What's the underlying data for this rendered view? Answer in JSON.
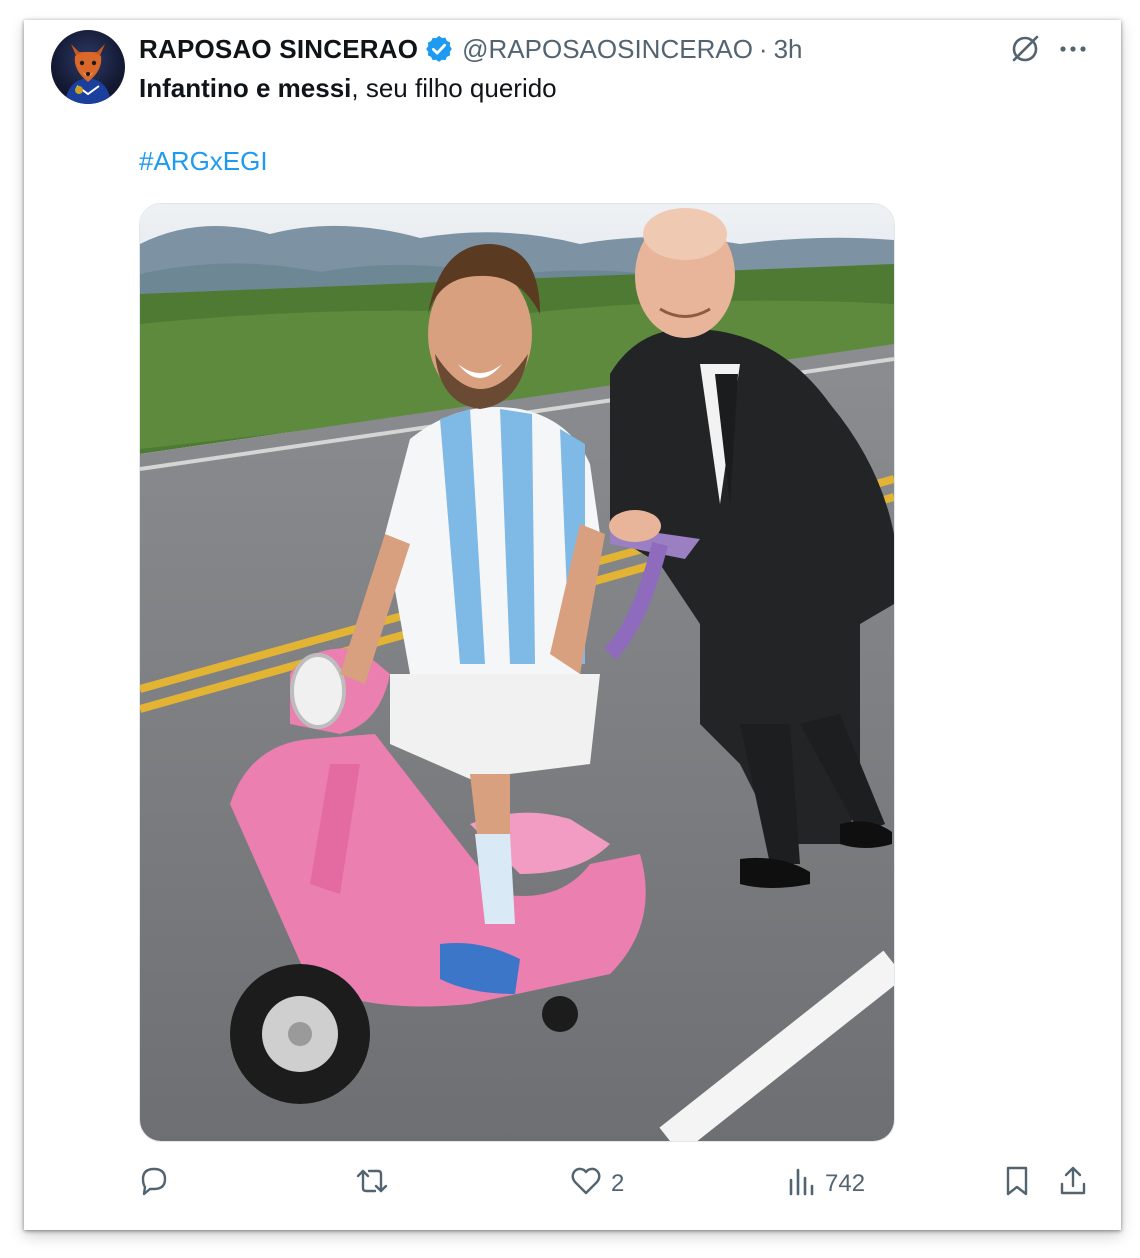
{
  "tweet": {
    "author_name": "RAPOSAO SINCERAO",
    "handle": "@RAPOSAOSINCERAO",
    "separator": "·",
    "time": "3h",
    "text_bold": "Infantino e messi",
    "text_rest": ", seu filho querido",
    "hashtag": "#ARGxEGI",
    "verified": true
  },
  "actions": {
    "reply_count": "",
    "retweet_count": "",
    "like_count": "2",
    "views_count": "742"
  },
  "colors": {
    "text_primary": "#0f1419",
    "text_secondary": "#536471",
    "link": "#1d9bf0",
    "verified_badge": "#1d9bf0"
  },
  "icons": {
    "header": [
      "grok-icon",
      "more-icon"
    ],
    "actions": [
      "reply-icon",
      "retweet-icon",
      "like-icon",
      "views-icon",
      "bookmark-icon",
      "share-icon"
    ]
  }
}
